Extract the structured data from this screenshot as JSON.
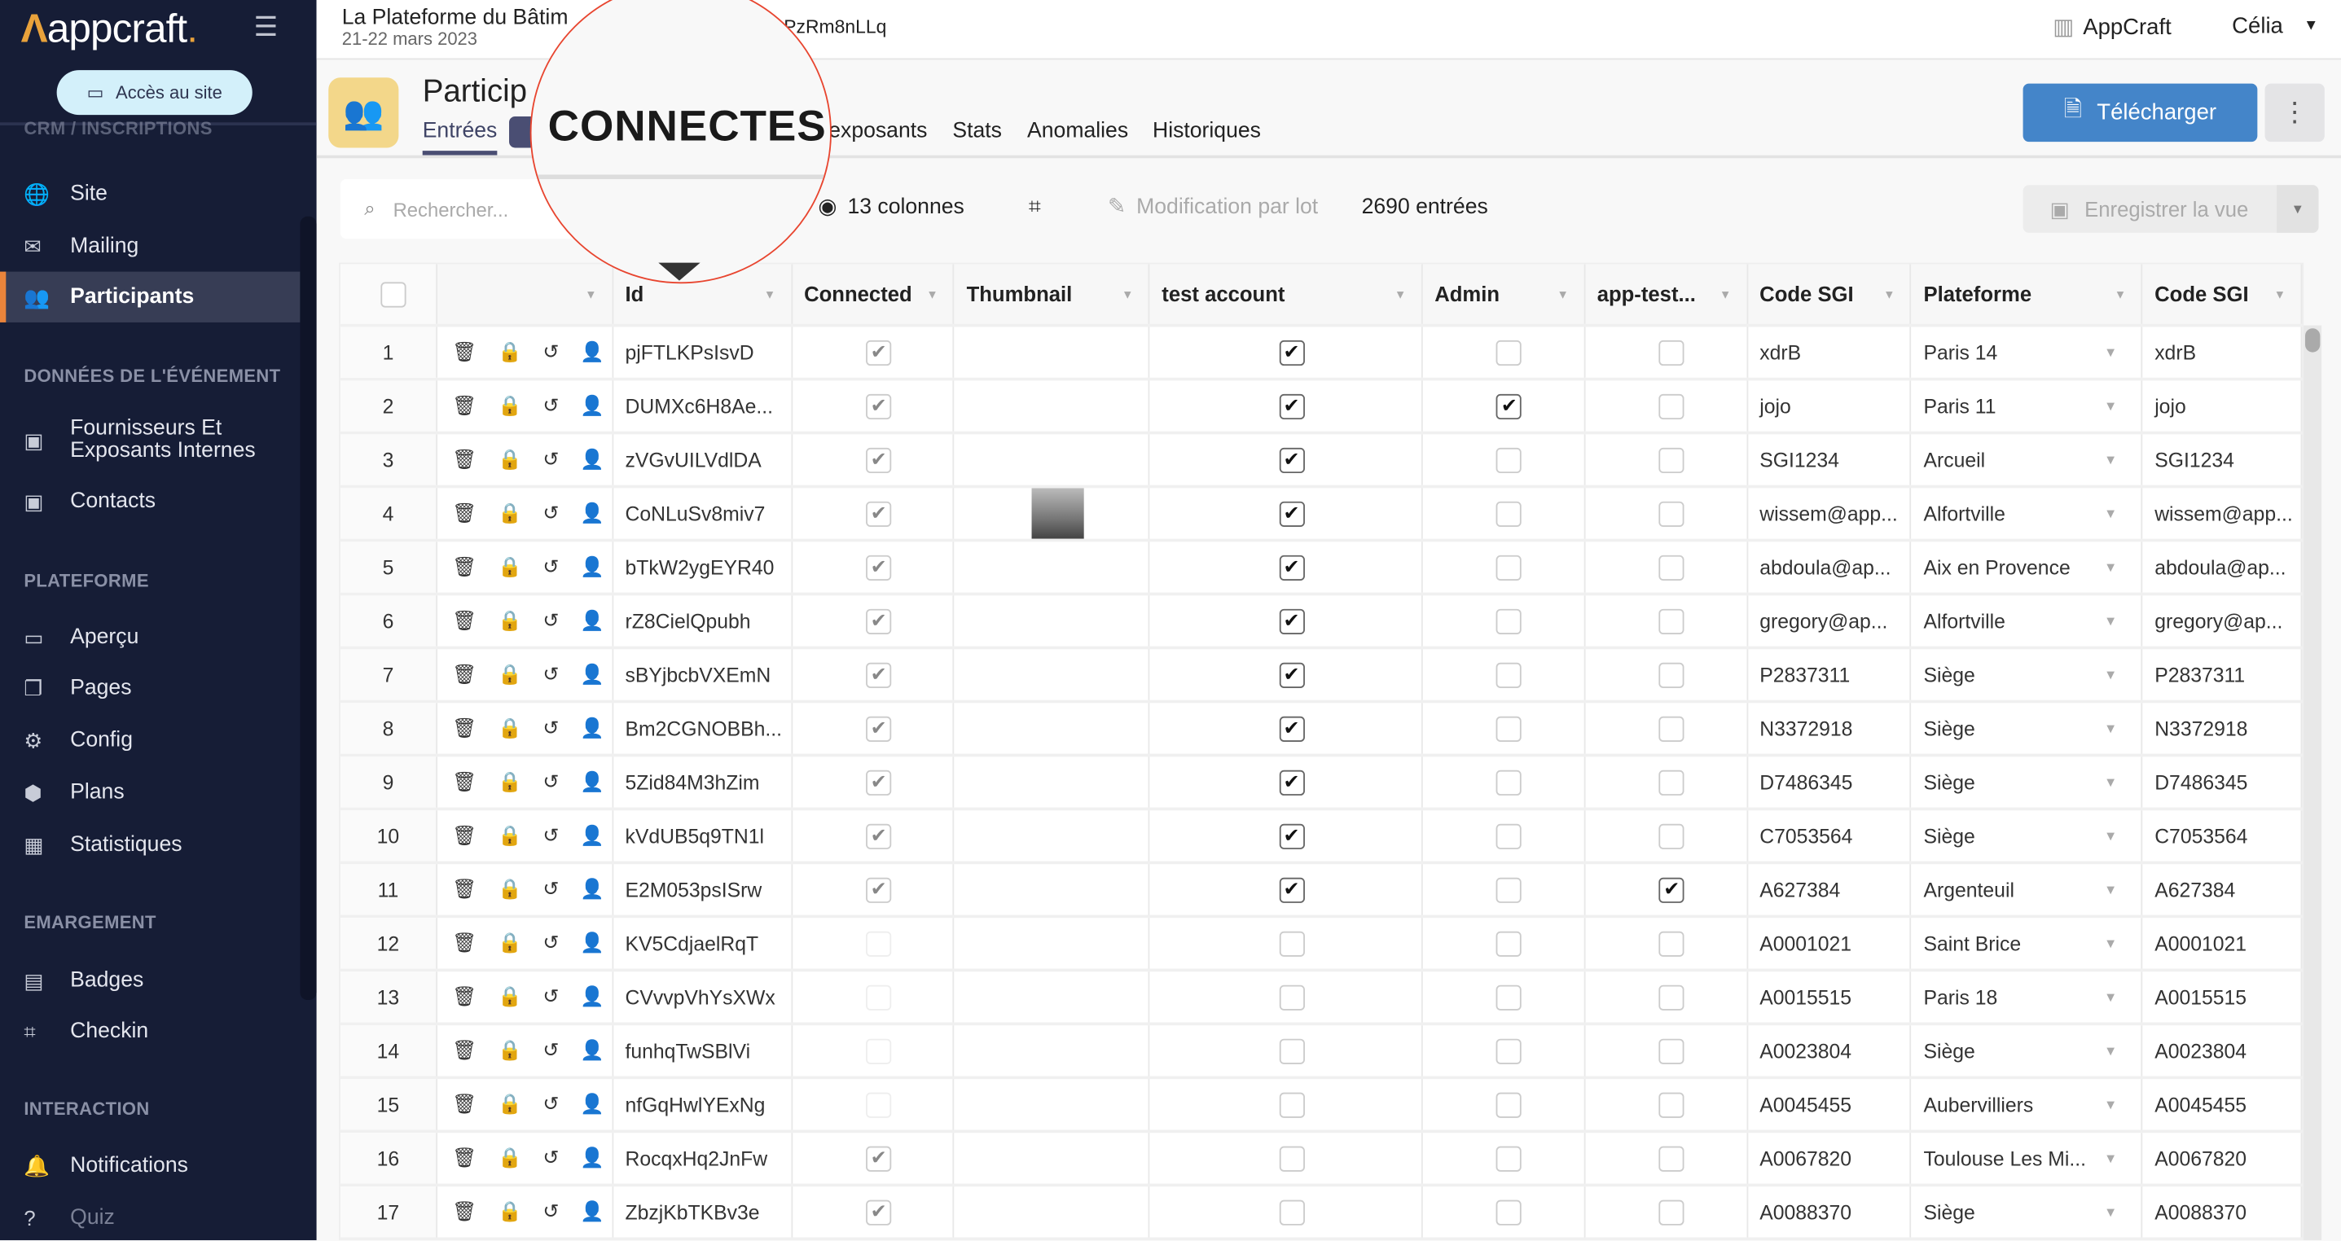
{
  "sidebar": {
    "logo": "appcraft",
    "site_button": "Accès au site",
    "sections": [
      {
        "label": "CRM / INSCRIPTIONS",
        "items": [
          {
            "label": "Site",
            "icon": "globe-icon"
          },
          {
            "label": "Mailing",
            "icon": "mail-icon"
          },
          {
            "label": "Participants",
            "icon": "users-icon",
            "active": true
          }
        ]
      },
      {
        "label": "DONNÉES DE L'ÉVÉNEMENT",
        "items": [
          {
            "label": "Fournisseurs Et Exposants Internes",
            "icon": "contact-card-icon"
          },
          {
            "label": "Contacts",
            "icon": "contact-card-icon"
          }
        ]
      },
      {
        "label": "PLATEFORME",
        "items": [
          {
            "label": "Aperçu",
            "icon": "laptop-icon"
          },
          {
            "label": "Pages",
            "icon": "pages-icon"
          },
          {
            "label": "Config",
            "icon": "config-icon"
          },
          {
            "label": "Plans",
            "icon": "map-pin-icon"
          },
          {
            "label": "Statistiques",
            "icon": "dashboard-icon"
          }
        ]
      },
      {
        "label": "EMARGEMENT",
        "items": [
          {
            "label": "Badges",
            "icon": "badge-icon"
          },
          {
            "label": "Checkin",
            "icon": "qr-code-icon"
          }
        ]
      },
      {
        "label": "INTERACTION",
        "items": [
          {
            "label": "Notifications",
            "icon": "bell-icon"
          },
          {
            "label": "Quiz",
            "icon": "quiz-icon"
          }
        ]
      }
    ]
  },
  "topbar": {
    "event_title": "La Plateforme du Bâtim",
    "event_date": "21-22 mars 2023",
    "record_id": "PzRm8nLLq",
    "org": "AppCraft",
    "user": "Célia"
  },
  "header": {
    "title": "Particip",
    "tabs": [
      "Entrées",
      "exposants",
      "Stats",
      "Anomalies",
      "Historiques"
    ],
    "download": "Télécharger"
  },
  "magnifier": {
    "text": "CONNECTES"
  },
  "toolbar": {
    "search_placeholder": "Rechercher...",
    "columns": "13 colonnes",
    "batch_edit": "Modification par lot",
    "entries": "2690 entrées",
    "save_view": "Enregistrer la vue"
  },
  "table": {
    "columns": [
      "",
      "",
      "Id",
      "Connected",
      "Thumbnail",
      "test account",
      "Admin",
      "app-test...",
      "Code SGI",
      "Plateforme",
      "Code SGI"
    ],
    "rows": [
      {
        "n": "1",
        "id": "pjFTLKPsIsvD",
        "connected": true,
        "thumb": false,
        "test": true,
        "admin": false,
        "apptest": false,
        "sgi": "xdrB",
        "plat": "Paris 14"
      },
      {
        "n": "2",
        "id": "DUMXc6H8Ae...",
        "connected": true,
        "thumb": false,
        "test": true,
        "admin": true,
        "apptest": false,
        "sgi": "jojo",
        "plat": "Paris 11"
      },
      {
        "n": "3",
        "id": "zVGvUILVdlDA",
        "connected": true,
        "thumb": false,
        "test": true,
        "admin": false,
        "apptest": false,
        "sgi": "SGI1234",
        "plat": "Arcueil"
      },
      {
        "n": "4",
        "id": "CoNLuSv8miv7",
        "connected": true,
        "thumb": true,
        "test": true,
        "admin": false,
        "apptest": false,
        "sgi": "wissem@app...",
        "plat": "Alfortville"
      },
      {
        "n": "5",
        "id": "bTkW2ygEYR40",
        "connected": true,
        "thumb": false,
        "test": true,
        "admin": false,
        "apptest": false,
        "sgi": "abdoula@ap...",
        "plat": "Aix en Provence"
      },
      {
        "n": "6",
        "id": "rZ8CielQpubh",
        "connected": true,
        "thumb": false,
        "test": true,
        "admin": false,
        "apptest": false,
        "sgi": "gregory@ap...",
        "plat": "Alfortville"
      },
      {
        "n": "7",
        "id": "sBYjbcbVXEmN",
        "connected": true,
        "thumb": false,
        "test": true,
        "admin": false,
        "apptest": false,
        "sgi": "P2837311",
        "plat": "Siège"
      },
      {
        "n": "8",
        "id": "Bm2CGNOBBh...",
        "connected": true,
        "thumb": false,
        "test": true,
        "admin": false,
        "apptest": false,
        "sgi": "N3372918",
        "plat": "Siège"
      },
      {
        "n": "9",
        "id": "5Zid84M3hZim",
        "connected": true,
        "thumb": false,
        "test": true,
        "admin": false,
        "apptest": false,
        "sgi": "D7486345",
        "plat": "Siège"
      },
      {
        "n": "10",
        "id": "kVdUB5q9TN1l",
        "connected": true,
        "thumb": false,
        "test": true,
        "admin": false,
        "apptest": false,
        "sgi": "C7053564",
        "plat": "Siège"
      },
      {
        "n": "11",
        "id": "E2M053psISrw",
        "connected": true,
        "thumb": false,
        "test": true,
        "admin": false,
        "apptest": true,
        "sgi": "A627384",
        "plat": "Argenteuil"
      },
      {
        "n": "12",
        "id": "KV5CdjaelRqT",
        "connected": false,
        "thumb": false,
        "test": false,
        "admin": false,
        "apptest": false,
        "sgi": "A0001021",
        "plat": "Saint Brice"
      },
      {
        "n": "13",
        "id": "CVvvpVhYsXWx",
        "connected": false,
        "thumb": false,
        "test": false,
        "admin": false,
        "apptest": false,
        "sgi": "A0015515",
        "plat": "Paris 18"
      },
      {
        "n": "14",
        "id": "funhqTwSBlVi",
        "connected": false,
        "thumb": false,
        "test": false,
        "admin": false,
        "apptest": false,
        "sgi": "A0023804",
        "plat": "Siège"
      },
      {
        "n": "15",
        "id": "nfGqHwlYExNg",
        "connected": false,
        "thumb": false,
        "test": false,
        "admin": false,
        "apptest": false,
        "sgi": "A0045455",
        "plat": "Aubervilliers"
      },
      {
        "n": "16",
        "id": "RocqxHq2JnFw",
        "connected": true,
        "thumb": false,
        "test": false,
        "admin": false,
        "apptest": false,
        "sgi": "A0067820",
        "plat": "Toulouse Les Mi..."
      },
      {
        "n": "17",
        "id": "ZbzjKbTKBv3e",
        "connected": true,
        "thumb": false,
        "test": false,
        "admin": false,
        "apptest": false,
        "sgi": "A0088370",
        "plat": "Siège"
      }
    ]
  },
  "colors": {
    "sidebar": "#161d36",
    "accent": "#e9843b",
    "primary": "#4485c9",
    "header_icon_bg": "#f3d78a",
    "magnifier_border": "#e8452f"
  }
}
